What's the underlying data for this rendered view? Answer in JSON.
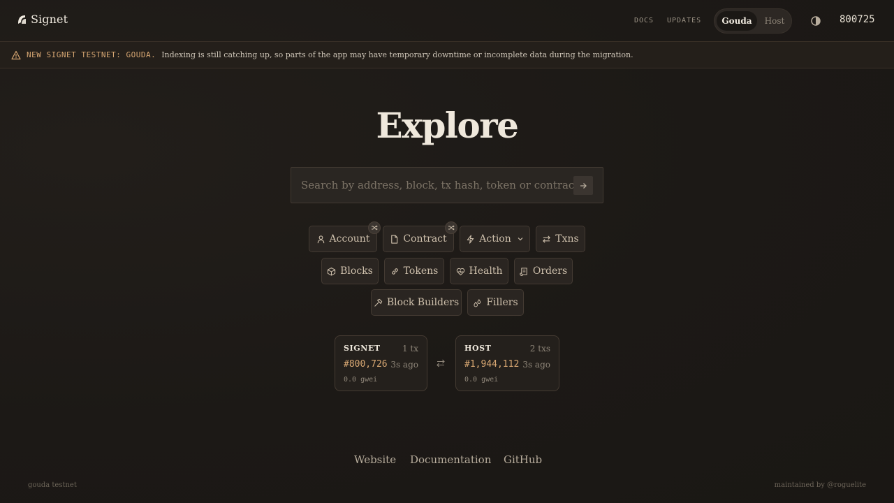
{
  "header": {
    "brand": "Signet",
    "nav": {
      "docs": "DOCS",
      "updates": "UPDATES"
    },
    "network_toggle": {
      "active": "Gouda",
      "inactive": "Host"
    },
    "block_number": "800725"
  },
  "banner": {
    "tag": "NEW SIGNET TESTNET: GOUDA.",
    "message": "Indexing is still catching up, so parts of the app may have temporary downtime or incomplete data during the migration."
  },
  "hero": {
    "title": "Explore"
  },
  "search": {
    "placeholder": "Search by address, block, tx hash, token or contract"
  },
  "quick_links": {
    "account": "Account",
    "contract": "Contract",
    "action": "Action",
    "txns": "Txns",
    "blocks": "Blocks",
    "tokens": "Tokens",
    "health": "Health",
    "orders": "Orders",
    "block_builders": "Block Builders",
    "fillers": "Fillers"
  },
  "chains": {
    "signet": {
      "label": "SIGNET",
      "tx_count": "1 tx",
      "block": "#800,726",
      "age": "3s ago",
      "gas": "0.0 gwei"
    },
    "host": {
      "label": "HOST",
      "tx_count": "2 txs",
      "block": "#1,944,112",
      "age": "3s ago",
      "gas": "0.0 gwei"
    }
  },
  "footer": {
    "links": {
      "website": "Website",
      "documentation": "Documentation",
      "github": "GitHub"
    },
    "left_note": "gouda testnet",
    "right_note": "maintained by @roguelite"
  },
  "colors": {
    "background": "#1c1916",
    "accent": "#d9a873",
    "chip_bg": "#2a2521",
    "border": "#433a32"
  },
  "icons": {
    "brand": "signet-logo-icon",
    "theme": "contrast-icon",
    "banner": "warning-icon",
    "search": "arrow-right-icon",
    "swap": "swap-icon"
  }
}
